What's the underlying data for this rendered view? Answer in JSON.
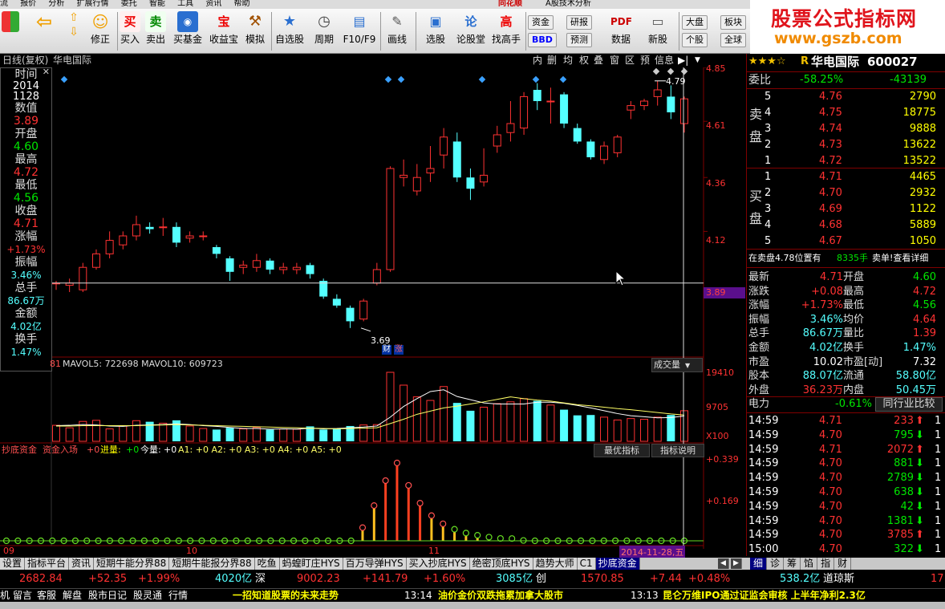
{
  "menu": [
    "流",
    "报价",
    "分析",
    "扩展行情",
    "委托",
    "智能",
    "工具",
    "资讯",
    "帮助"
  ],
  "menu_center": "同花顺",
  "menu_sub": "A股技术分析",
  "toolbar": {
    "buy": "买入",
    "sell": "卖出",
    "fund": "买基金",
    "profit": "收益宝",
    "sim": "模拟",
    "fix": "修正",
    "watch": "自选股",
    "period": "周期",
    "f10": "F10/F9",
    "draw": "画线",
    "pick": "选股",
    "forum": "论股堂",
    "master": "找高手",
    "data": "数据",
    "newstock": "新股",
    "fund2": "资金",
    "bbd": "BBD",
    "research": "研报",
    "forecast": "预测",
    "bigmkt": "大盘",
    "sector": "板块",
    "stock": "个股",
    "global": "全球",
    "buy_icon": "买",
    "sell_icon": "卖",
    "profit_icon": "宝",
    "forum_icon": "论",
    "master_icon": "高"
  },
  "brand": {
    "title": "股票公式指标网",
    "url": "www.gszb.com"
  },
  "chart_header": {
    "mode": "日线(复权)",
    "name": "华电国际",
    "buttons": [
      "内",
      "删",
      "均",
      "权",
      "叠",
      "窗",
      "区",
      "预",
      "信息"
    ]
  },
  "info": {
    "time_label": "时间",
    "year": "2014",
    "date": "1128",
    "value_label": "数值",
    "value": "3.89",
    "open_label": "开盘",
    "open": "4.60",
    "high_label": "最高",
    "high": "4.72",
    "low_label": "最低",
    "low": "4.56",
    "close_label": "收盘",
    "close": "4.71",
    "chg_label": "涨幅",
    "chg": "+1.73%",
    "amp_label": "振幅",
    "amp": "3.46%",
    "vol_label": "总手",
    "vol": "86.67万",
    "amt_label": "金额",
    "amt": "4.02亿",
    "turn_label": "换手",
    "turn": "1.47%"
  },
  "price_axis": [
    "4.85",
    "4.61",
    "4.36",
    "4.12",
    "3.89"
  ],
  "annot": {
    "high": "4.79",
    "low": "3.69",
    "badge1": "财",
    "badge2": "涨"
  },
  "vol_header": {
    "text": "MAVOL5: 722698  MAVOL10: 609723",
    "num": "81",
    "sel": "成交量",
    "axis": [
      "19410",
      "9705",
      "X100"
    ]
  },
  "ind_header": {
    "name": "抄底资金",
    "p1": "资金入场",
    "v1": "+0",
    "p2": "进量:",
    "v2": "+0",
    "p3": "今量:",
    "v3": "+0",
    "rest": "A1: +0  A2: +0  A3: +0  A4: +0  A5: +0",
    "btn1": "最优指标",
    "btn2": "指标说明",
    "axis": [
      "+0.339",
      "+0.169"
    ]
  },
  "xaxis": {
    "l1": "09",
    "l2": "10",
    "l3": "11",
    "cur": "2014-11-28,五"
  },
  "tabs": [
    "设置",
    "指标平台",
    "资讯",
    "短期牛能分界88",
    "短期牛能报分界88",
    "吃鱼",
    "蚂蝗盯庄HYS",
    "百万导弹HYS",
    "买入抄底HYS",
    "绝密顶底HYS",
    "趋势大师",
    "C1",
    "抄底资金"
  ],
  "rtabs": [
    "细",
    "诊",
    "筹",
    "馅",
    "指",
    "财"
  ],
  "quote": {
    "title": "华电国际",
    "code": "600027",
    "r": "R",
    "wb_label": "委比",
    "wb": "-58.25%",
    "wc": "-43139",
    "sell_label": "卖盘",
    "buy_label": "买盘",
    "asks": [
      [
        "5",
        "4.76",
        "2790"
      ],
      [
        "4",
        "4.75",
        "18775"
      ],
      [
        "3",
        "4.74",
        "9888"
      ],
      [
        "2",
        "4.73",
        "13622"
      ],
      [
        "1",
        "4.72",
        "13522"
      ]
    ],
    "bids": [
      [
        "1",
        "4.71",
        "4465"
      ],
      [
        "2",
        "4.70",
        "2932"
      ],
      [
        "3",
        "4.69",
        "1122"
      ],
      [
        "4",
        "4.68",
        "5889"
      ],
      [
        "5",
        "4.67",
        "1050"
      ]
    ],
    "notice1": "在卖盘4.78位置有",
    "notice2": "8335手",
    "notice3": "卖单!查看详细",
    "stats": [
      [
        "最新",
        "4.71",
        "开盘",
        "4.60"
      ],
      [
        "涨跌",
        "+0.08",
        "最高",
        "4.72"
      ],
      [
        "涨幅",
        "+1.73%",
        "最低",
        "4.56"
      ],
      [
        "振幅",
        "3.46%",
        "均价",
        "4.64"
      ],
      [
        "总手",
        "86.67万",
        "量比",
        "1.39"
      ],
      [
        "金额",
        "4.02亿",
        "换手",
        "1.47%"
      ],
      [
        "市盈",
        "10.02",
        "市盈[动]",
        "7.32"
      ],
      [
        "股本",
        "88.07亿",
        "流通",
        "58.80亿"
      ],
      [
        "外盘",
        "36.23万",
        "内盘",
        "50.45万"
      ]
    ],
    "sector_label": "电力",
    "sector_chg": "-0.61%",
    "compare": "同行业比较",
    "ticks": [
      [
        "14:59",
        "4.71",
        "233",
        "up"
      ],
      [
        "14:59",
        "4.70",
        "795",
        "down"
      ],
      [
        "14:59",
        "4.71",
        "2072",
        "up"
      ],
      [
        "14:59",
        "4.70",
        "881",
        "down"
      ],
      [
        "14:59",
        "4.70",
        "2789",
        "down"
      ],
      [
        "14:59",
        "4.70",
        "638",
        "down"
      ],
      [
        "14:59",
        "4.70",
        "42",
        "down"
      ],
      [
        "14:59",
        "4.70",
        "1381",
        "down"
      ],
      [
        "14:59",
        "4.70",
        "3785",
        "up"
      ],
      [
        "15:00",
        "4.70",
        "322",
        "down"
      ]
    ]
  },
  "ticker": {
    "a": "2682.84",
    "b": "+52.35",
    "c": "+1.99%",
    "d": "4020亿",
    "e": "深",
    "f": "9002.23",
    "g": "+141.79",
    "h": "+1.60%",
    "i": "3085亿",
    "j": "创",
    "k": "1570.85",
    "l": "+7.44",
    "m": "+0.48%",
    "n": "538.2亿",
    "o": "道琼斯",
    "p": "17"
  },
  "status": {
    "items": [
      "机",
      "留言",
      "客服",
      "解盘",
      "股市日记",
      "股灵通",
      "行情"
    ],
    "news1": "一招知道股票的未来走势",
    "t2": "13:14",
    "news2": "油价金价双跌拖累加拿大股市",
    "t3": "13:13",
    "news3": "昆仑万维IPO通过证监会审核 上半年净利2.3亿"
  },
  "colors": {
    "up": "#ff3232",
    "down": "#54ffff",
    "bg": "#000000",
    "axis": "#800000"
  },
  "chart_data": {
    "type": "candlestick",
    "ylim": [
      3.6,
      4.85
    ],
    "candles": [
      [
        3.89,
        3.89,
        3.86,
        3.9
      ],
      [
        3.88,
        3.89,
        3.85,
        3.91
      ],
      [
        3.86,
        3.96,
        3.85,
        3.98
      ],
      [
        3.96,
        4.02,
        3.95,
        4.04
      ],
      [
        4.02,
        4.08,
        4.0,
        4.12
      ],
      [
        4.06,
        4.1,
        4.04,
        4.12
      ],
      [
        4.1,
        4.15,
        4.08,
        4.19
      ],
      [
        4.14,
        4.13,
        4.11,
        4.16
      ],
      [
        4.14,
        4.14,
        4.1,
        4.18
      ],
      [
        4.14,
        4.07,
        4.05,
        4.16
      ],
      [
        4.09,
        4.1,
        4.07,
        4.12
      ],
      [
        4.1,
        4.1,
        4.08,
        4.12
      ],
      [
        4.05,
        4.02,
        4.0,
        4.06
      ],
      [
        4.0,
        3.94,
        3.9,
        4.01
      ],
      [
        3.96,
        3.97,
        3.93,
        3.99
      ],
      [
        3.96,
        3.99,
        3.94,
        4.02
      ],
      [
        3.99,
        3.95,
        3.93,
        4.0
      ],
      [
        3.95,
        3.96,
        3.93,
        3.98
      ],
      [
        3.95,
        3.96,
        3.93,
        3.98
      ],
      [
        3.97,
        3.93,
        3.91,
        3.98
      ],
      [
        3.9,
        3.83,
        3.82,
        3.91
      ],
      [
        3.82,
        3.79,
        3.78,
        3.84
      ],
      [
        3.78,
        3.72,
        3.69,
        3.79
      ],
      [
        3.73,
        3.81,
        3.72,
        3.82
      ],
      [
        3.89,
        3.95,
        3.88,
        3.98
      ],
      [
        3.95,
        4.4,
        3.94,
        4.41
      ],
      [
        4.36,
        4.37,
        4.32,
        4.44
      ],
      [
        4.3,
        4.36,
        4.28,
        4.42
      ],
      [
        4.38,
        4.4,
        4.34,
        4.5
      ],
      [
        4.46,
        4.54,
        4.4,
        4.58
      ],
      [
        4.52,
        4.36,
        4.34,
        4.56
      ],
      [
        4.36,
        4.31,
        4.26,
        4.4
      ],
      [
        4.34,
        4.37,
        4.32,
        4.49
      ],
      [
        4.5,
        4.55,
        4.47,
        4.59
      ],
      [
        4.56,
        4.6,
        4.52,
        4.7
      ],
      [
        4.58,
        4.72,
        4.55,
        4.74
      ],
      [
        4.75,
        4.7,
        4.66,
        4.78
      ],
      [
        4.7,
        4.7,
        4.6,
        4.76
      ],
      [
        4.73,
        4.6,
        4.58,
        4.74
      ],
      [
        4.58,
        4.52,
        4.51,
        4.6
      ],
      [
        4.52,
        4.45,
        4.44,
        4.53
      ],
      [
        4.44,
        4.5,
        4.42,
        4.52
      ],
      [
        4.47,
        4.54,
        4.45,
        4.55
      ],
      [
        4.66,
        4.68,
        4.62,
        4.7
      ],
      [
        4.68,
        4.7,
        4.66,
        4.71
      ],
      [
        4.72,
        4.75,
        4.68,
        4.79
      ],
      [
        4.72,
        4.65,
        4.62,
        4.77
      ],
      [
        4.6,
        4.71,
        4.56,
        4.72
      ]
    ],
    "volume_max": 19410,
    "volumes": [
      4500,
      3800,
      5600,
      5900,
      3500,
      4400,
      5800,
      5500,
      5100,
      5900,
      4300,
      3600,
      3300,
      3800,
      3500,
      3900,
      3300,
      3500,
      3400,
      4200,
      3300,
      3600,
      4300,
      4600,
      4700,
      19410,
      15800,
      12500,
      11500,
      15400,
      10800,
      8600,
      9600,
      10600,
      11100,
      12000,
      11400,
      10200,
      8900,
      7300,
      7400,
      6800,
      6000,
      6400,
      6200,
      6800,
      7400,
      8600
    ],
    "mavol5": [
      4400,
      4500,
      4700,
      4600,
      4300,
      4200,
      4500,
      4600,
      4700,
      4900,
      4700,
      4400,
      4200,
      3900,
      3600,
      3600,
      3400,
      3500,
      3400,
      3700,
      3500,
      3600,
      3800,
      4000,
      4300,
      6800,
      9800,
      12000,
      14000,
      14500,
      12600,
      11700,
      10800,
      10500,
      10500,
      10500,
      11000,
      11000,
      10700,
      10100,
      9400,
      8600,
      7800,
      7200,
      6900,
      6600,
      6700,
      7100
    ],
    "mavol10": [
      4300,
      4300,
      4400,
      4400,
      4400,
      4400,
      4400,
      4500,
      4600,
      4700,
      4600,
      4500,
      4400,
      4300,
      4200,
      4100,
      4000,
      3900,
      3800,
      3700,
      3600,
      3500,
      3600,
      3700,
      3800,
      5000,
      6200,
      7600,
      8500,
      9400,
      9900,
      10500,
      11100,
      11800,
      12500,
      12000,
      11600,
      11300,
      10800,
      10300,
      10000,
      9600,
      9200,
      8900,
      8500,
      8100,
      7700,
      7400
    ],
    "indicator": [
      0,
      0,
      0,
      0,
      0,
      0,
      0,
      0,
      0,
      0,
      0,
      0,
      0,
      0,
      0,
      0,
      0,
      0,
      0,
      0,
      0,
      0,
      0,
      0,
      0,
      0.08,
      0.22,
      0.339,
      0.22,
      0.13,
      0.08,
      0.05,
      0.03,
      0.02,
      0.01,
      0.01,
      0,
      0,
      0,
      0,
      0,
      0,
      0,
      0,
      0,
      0,
      0,
      0
    ],
    "indicator_ylim": [
      0,
      0.339
    ]
  }
}
